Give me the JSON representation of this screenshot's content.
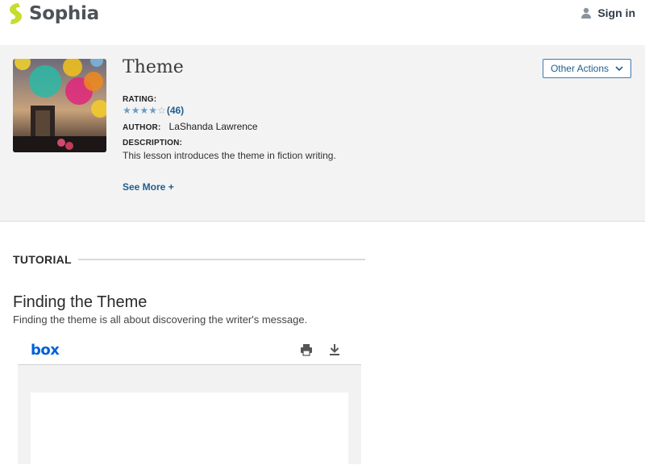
{
  "header": {
    "brand": "Sophia",
    "sign_in": "Sign in",
    "colors": {
      "brand_green": "#c5d92d",
      "brand_text": "#4d5358"
    }
  },
  "lesson": {
    "title": "Theme",
    "rating_label": "RATING:",
    "rating_stars": 4,
    "rating_max": 5,
    "rating_count": "(46)",
    "author_label": "AUTHOR:",
    "author_name": "LaShanda Lawrence",
    "description_label": "DESCRIPTION:",
    "description": "This lesson introduces the theme in fiction writing.",
    "see_more": "See More +",
    "other_actions": "Other Actions"
  },
  "tutorial": {
    "section_label": "TUTORIAL",
    "heading": "Finding the Theme",
    "subheading": "Finding the theme is all about discovering the writer's message."
  },
  "viewer": {
    "brand": "box",
    "icons": [
      "print-icon",
      "download-icon"
    ]
  }
}
